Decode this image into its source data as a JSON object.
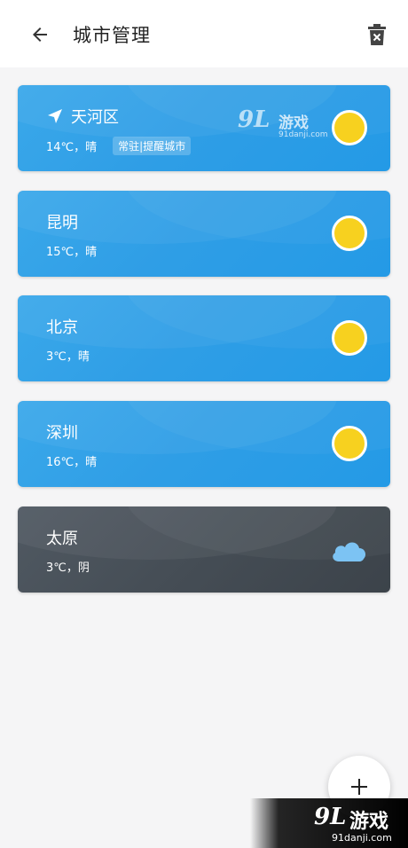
{
  "header": {
    "title": "城市管理",
    "back_icon": "arrow-left-icon",
    "delete_icon": "trash-icon"
  },
  "cities": [
    {
      "name": "天河区",
      "weather": "14℃，晴",
      "badge": "常驻|提醒城市",
      "is_location": true,
      "condition": "sunny"
    },
    {
      "name": "昆明",
      "weather": "15℃，晴",
      "condition": "sunny"
    },
    {
      "name": "北京",
      "weather": "3℃，晴",
      "condition": "sunny"
    },
    {
      "name": "深圳",
      "weather": "16℃，晴",
      "condition": "sunny"
    },
    {
      "name": "太原",
      "weather": "3℃，阴",
      "condition": "cloudy"
    }
  ],
  "fab": {
    "icon": "plus-icon"
  },
  "watermark": {
    "logo": "9L",
    "text": "游戏",
    "url": "91danji.com"
  },
  "colors": {
    "sunny_card": "#2f9ee6",
    "cloudy_card": "#454d55",
    "sun": "#f7d11f",
    "cloud": "#7cc3f3"
  }
}
